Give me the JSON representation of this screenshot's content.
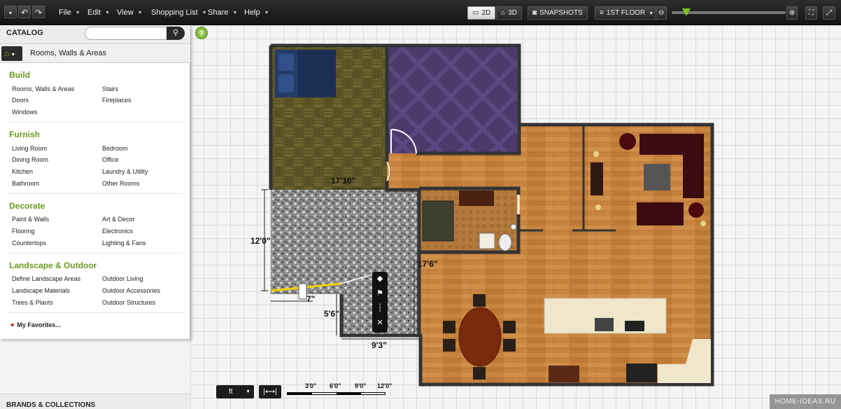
{
  "toolbar": {
    "menus": [
      "File",
      "Edit",
      "View",
      "Shopping List",
      "Share",
      "Help"
    ],
    "view_2d": "2D",
    "view_3d": "3D",
    "snapshots": "SNAPSHOTS",
    "floor": "1ST FLOOR",
    "zoom_level": 0.13
  },
  "catalog": {
    "title": "CATALOG",
    "search_placeholder": "",
    "breadcrumb": "Rooms, Walls & Areas",
    "sections": [
      {
        "title": "Build",
        "items": [
          "Rooms, Walls & Areas",
          "Stairs",
          "Doors",
          "Fireplaces",
          "Windows"
        ]
      },
      {
        "title": "Furnish",
        "items": [
          "Living Room",
          "Bedroom",
          "Dining Room",
          "Office",
          "Kitchen",
          "Laundry & Utility",
          "Bathroom",
          "Other Rooms"
        ]
      },
      {
        "title": "Decorate",
        "items": [
          "Paint & Walls",
          "Art & Decor",
          "Flooring",
          "Electronics",
          "Countertops",
          "Lighting & Fans"
        ]
      },
      {
        "title": "Landscape & Outdoor",
        "items": [
          "Define Landscape Areas",
          "Outdoor Living",
          "Landscape Materials",
          "Outdoor Accessories",
          "Trees & Plants",
          "Outdoor Structures"
        ]
      }
    ],
    "favorites": "My Favorites...",
    "brands": "BRANDS & COLLECTIONS"
  },
  "help": "?",
  "dimensions": {
    "d1": "17'10\"",
    "d2": "12'0\"",
    "d3": "17'6\"",
    "d4": "7\"",
    "d5": "5'6\"",
    "d6": "9'3\""
  },
  "bottom": {
    "unit": "ft",
    "scale_labels": [
      "3'0\"",
      "6'0\"",
      "9'0\"",
      "12'0\""
    ]
  },
  "watermark": "HOME-IDEAS.RU",
  "colors": {
    "accent_green": "#7ac51b",
    "section_green": "#6a9a1f",
    "wood_floor": "#c8833f",
    "purple_room": "#4c3a6b",
    "olive_room": "#5d5525"
  }
}
